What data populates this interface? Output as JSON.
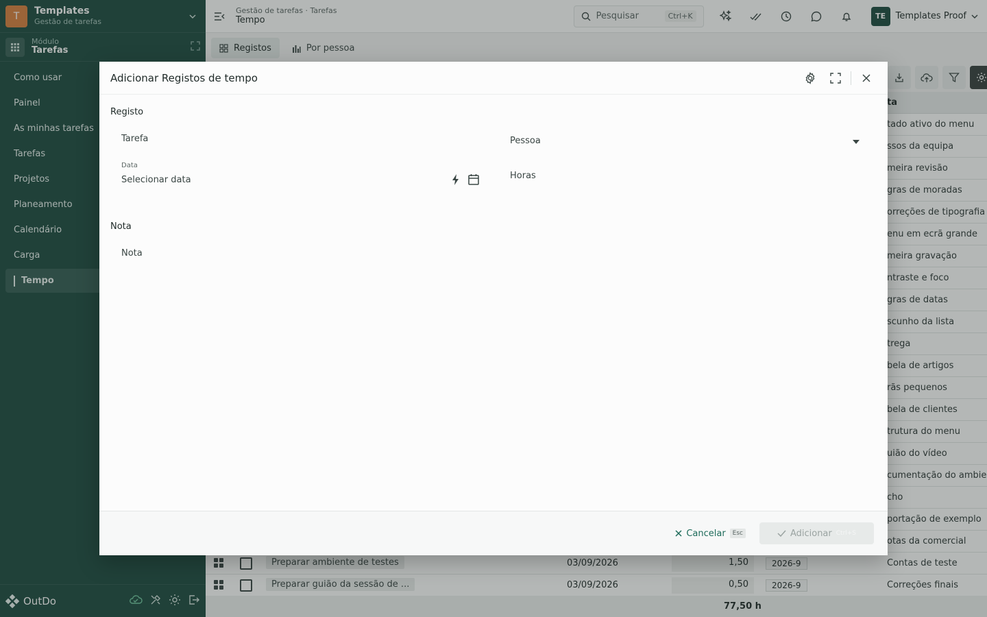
{
  "sidebar": {
    "logo_letter": "T",
    "app_title": "Templates",
    "app_subtitle": "Gestão de tarefas",
    "module_label": "Módulo",
    "module_name": "Tarefas",
    "items": [
      {
        "label": "Como usar"
      },
      {
        "label": "Painel"
      },
      {
        "label": "As minhas tarefas"
      },
      {
        "label": "Tarefas"
      },
      {
        "label": "Projetos"
      },
      {
        "label": "Planeamento"
      },
      {
        "label": "Calendário"
      },
      {
        "label": "Carga"
      },
      {
        "label": "Tempo"
      }
    ],
    "brand": "OutDo"
  },
  "topbar": {
    "breadcrumb": "Gestão de tarefas · Tarefas",
    "page_title": "Tempo",
    "search_placeholder": "Pesquisar",
    "search_shortcut": "Ctrl+K",
    "avatar_initials": "TE",
    "user_name": "Templates Proof"
  },
  "tabs": [
    {
      "label": "Registos"
    },
    {
      "label": "Por pessoa"
    }
  ],
  "table": {
    "note_header": "ta",
    "notes": [
      "tado ativo do menu",
      "ssos da equipa",
      "meira revisão",
      "gras de moradas",
      "orreções de tipografia",
      "enu em ecrã grande",
      "meira gravação",
      "ntraste e foco",
      "gras de datas",
      "scunho da lista",
      "trega",
      "bela de artigos",
      "rãs pequenos",
      "bela de clientes",
      "trutura do menu",
      "uião do vídeo",
      "cumentação do ambien",
      "cho",
      "portação de exemplo",
      "otas da comercial"
    ],
    "rows": [
      {
        "task": "Preparar ambiente de testes",
        "date": "03/09/2026",
        "hours": "1,50",
        "week": "2026-9",
        "note": "Contas de teste"
      },
      {
        "task": "Preparar guião da sessão de ...",
        "date": "03/09/2026",
        "hours": "0,50",
        "week": "2026-9",
        "note": "Correções finais"
      }
    ],
    "total": "77,50 h"
  },
  "modal": {
    "title": "Adicionar Registos de tempo",
    "section_registo": "Registo",
    "field_tarefa": "Tarefa",
    "field_pessoa": "Pessoa",
    "field_data_label": "Data",
    "field_data_placeholder": "Selecionar data",
    "field_horas": "Horas",
    "section_nota": "Nota",
    "field_nota": "Nota",
    "cancel_label": "Cancelar",
    "cancel_shortcut": "Esc",
    "add_label": "Adicionar",
    "add_shortcut": "Ctrl+S"
  },
  "colors": {
    "sidebar_bg": "#1d4a40",
    "logo_bg": "#d9803e",
    "accent": "#1d6b5a"
  }
}
